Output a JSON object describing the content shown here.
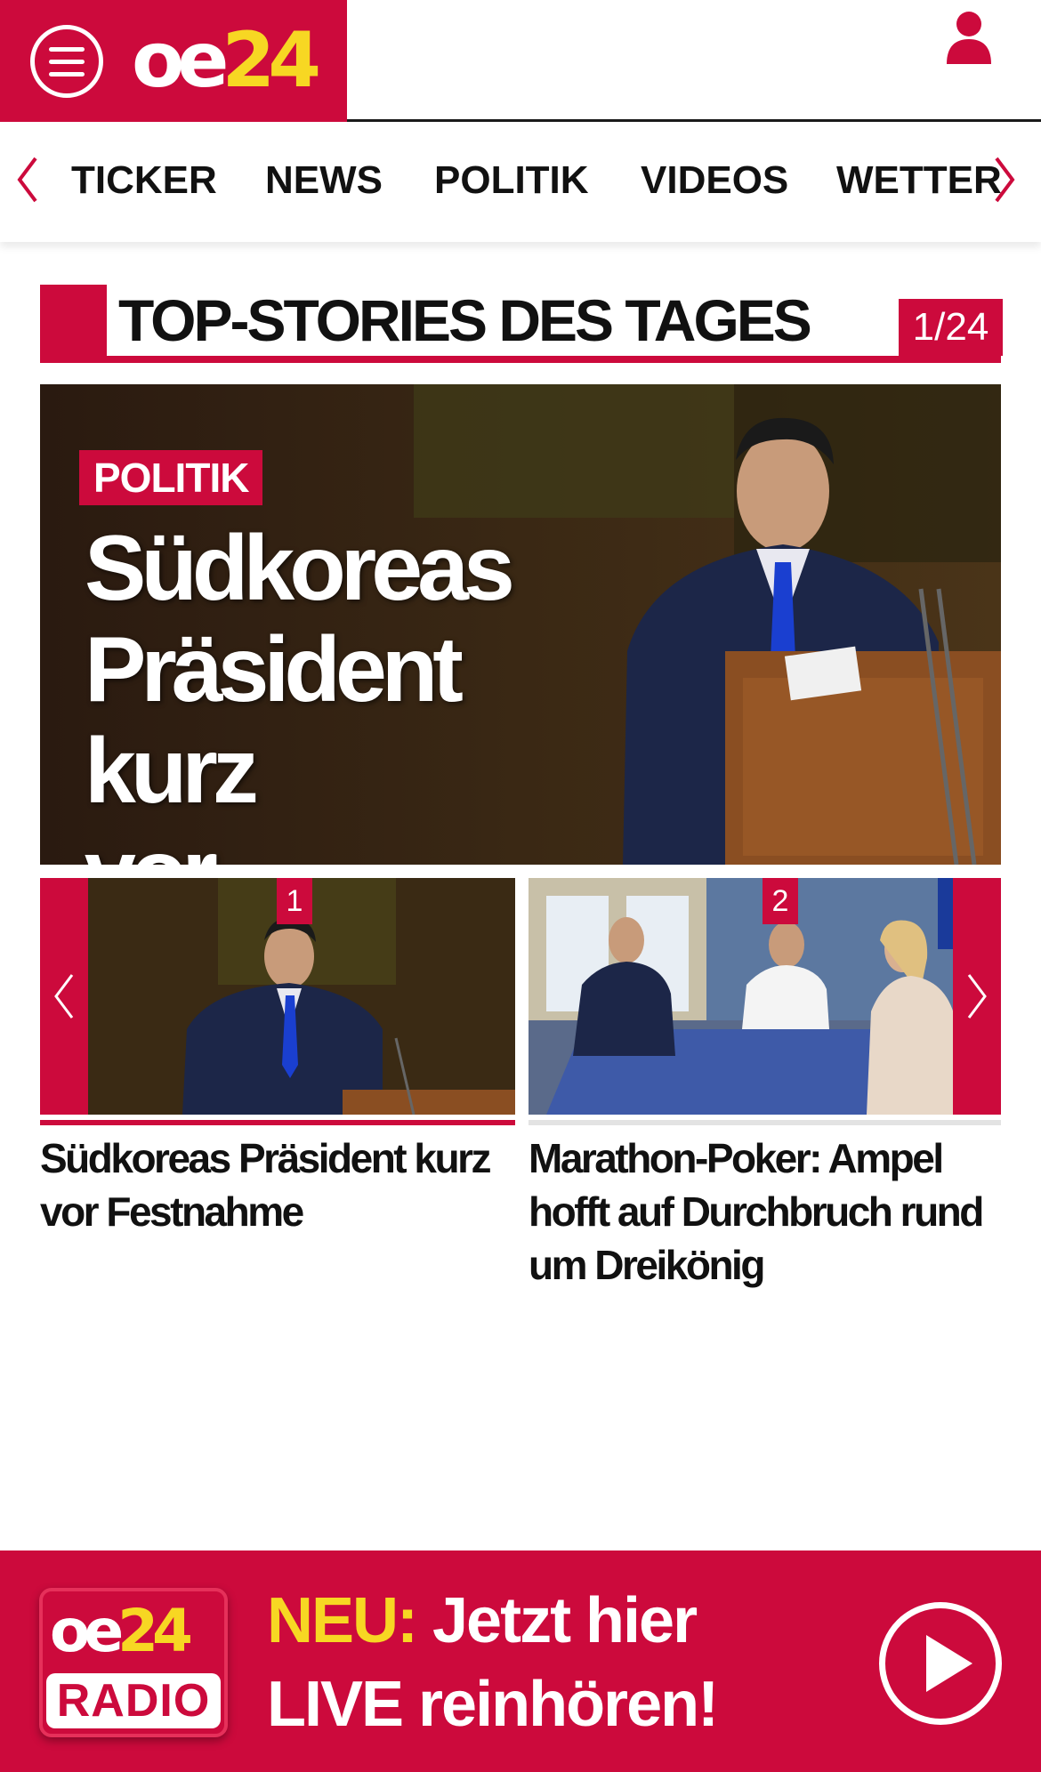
{
  "header": {
    "logo": {
      "part1": "oe",
      "part2": "24"
    },
    "menu_icon": "hamburger-menu-icon",
    "user_icon": "user-icon",
    "brand_color": "#cc0a3c",
    "accent_color": "#f7d723"
  },
  "nav": {
    "items": [
      "TICKER",
      "NEWS",
      "POLITIK",
      "VIDEOS",
      "WETTER"
    ],
    "left_icon": "chevron-left-icon",
    "right_icon": "chevron-right-icon"
  },
  "section": {
    "title": "TOP-STORIES DES TAGES",
    "counter": "1/24"
  },
  "hero": {
    "category": "POLITIK",
    "headline_lines": [
      "Südkoreas",
      "Präsident kurz",
      "vor Festnahme"
    ]
  },
  "carousel": {
    "cards": [
      {
        "number": "1",
        "title": "Südkoreas Präsident kurz vor Festnahme"
      },
      {
        "number": "2",
        "title": "Marathon-Poker: Ampel hofft auf Durchbruch rund um Dreikönig"
      }
    ]
  },
  "radio": {
    "logo": {
      "part1": "oe",
      "part2": "24",
      "label": "RADIO"
    },
    "neu": "NEU:",
    "line1_rest": " Jetzt hier",
    "line2": "LIVE reinhören!",
    "play_icon": "play-icon"
  }
}
